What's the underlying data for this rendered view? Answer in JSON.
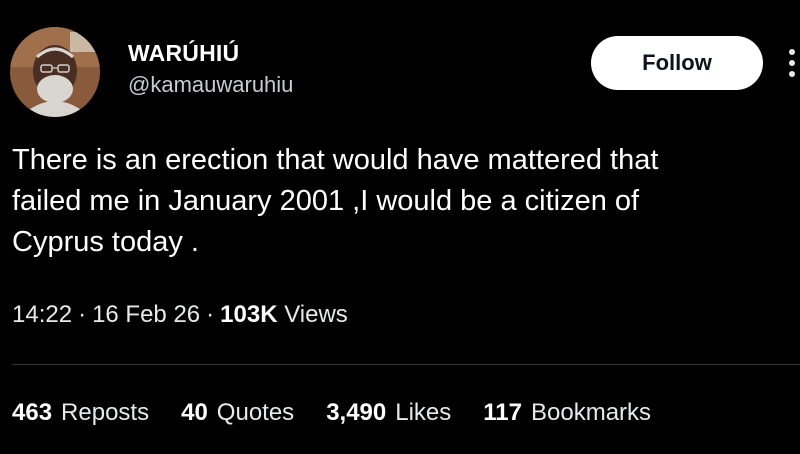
{
  "author": {
    "display_name": "WARÚHIÚ",
    "handle": "@kamauwaruhiu",
    "avatar_icon": "profile-photo"
  },
  "follow_button": {
    "label": "Follow"
  },
  "more_menu": {
    "icon": "more-vertical-icon"
  },
  "tweet": {
    "text_lines": [
      "There is an erection that would have mattered that",
      "failed me in January 2001 ,I would be a citizen of",
      "Cyprus today ."
    ]
  },
  "meta": {
    "time": "14:22",
    "separator": "·",
    "date": "16 Feb 26",
    "views_count": "103K",
    "views_label": "Views"
  },
  "stats": {
    "reposts": {
      "count": "463",
      "label": "Reposts"
    },
    "quotes": {
      "count": "40",
      "label": "Quotes"
    },
    "likes": {
      "count": "3,490",
      "label": "Likes"
    },
    "bookmarks": {
      "count": "117",
      "label": "Bookmarks"
    }
  },
  "colors": {
    "background": "#000000",
    "text_primary": "#ffffff",
    "text_secondary": "#e7e9ea",
    "divider": "#2f3336",
    "button_bg": "#ffffff",
    "button_text": "#0f1419"
  }
}
